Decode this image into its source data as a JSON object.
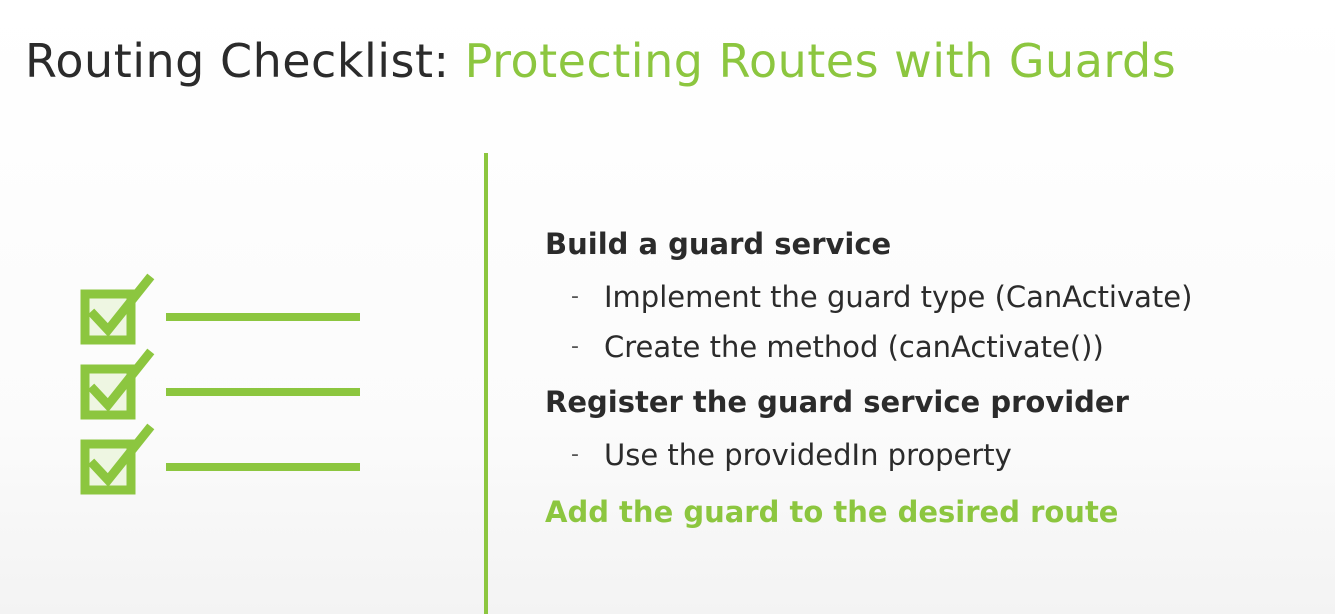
{
  "title": {
    "prefix": "Routing Checklist: ",
    "accent": "Protecting Routes with Guards"
  },
  "colors": {
    "accent": "#8cc63f",
    "text": "#2b2b2b"
  },
  "icons": {
    "checklist": "checklist-icon"
  },
  "sections": [
    {
      "heading": "Build a guard service",
      "bullets": [
        "Implement the guard type (CanActivate)",
        "Create the method (canActivate())"
      ]
    },
    {
      "heading": "Register the guard service provider",
      "bullets": [
        "Use the providedIn property"
      ]
    },
    {
      "heading": "Add the guard to the desired route",
      "highlight": true
    }
  ],
  "bullet_marker": "-"
}
